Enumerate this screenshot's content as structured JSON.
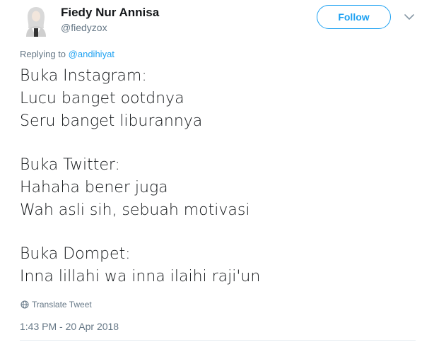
{
  "author": {
    "name": "Fiedy Nur Annisa",
    "handle": "@fiedyzox",
    "avatar_icon": "user-avatar"
  },
  "header": {
    "follow_label": "Follow",
    "caret_icon": "chevron-down-icon",
    "accent_color": "#1da1f2"
  },
  "reply": {
    "prefix": "Replying to",
    "mention": "@andihiyat"
  },
  "tweet": {
    "block1": [
      "Buka Instagram:",
      "Lucu banget ootdnya",
      "Seru banget liburannya"
    ],
    "block2": [
      "Buka Twitter:",
      "Hahaha bener juga",
      "Wah asli sih, sebuah motivasi"
    ],
    "block3": [
      "Buka Dompet:",
      "Inna lillahi wa inna ilaihi raji'un"
    ]
  },
  "footer": {
    "translate_label": "Translate Tweet",
    "translate_icon": "globe-icon",
    "timestamp": "1:43 PM - 20 Apr 2018"
  }
}
